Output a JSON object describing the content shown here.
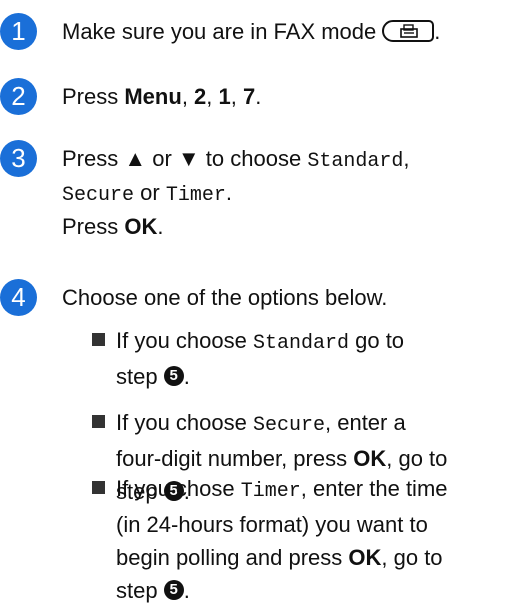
{
  "steps": [
    {
      "number": "1",
      "text": "Make sure you are in FAX mode",
      "end": "."
    },
    {
      "number": "2",
      "prefix": "Press ",
      "menu": "Menu",
      "sep1": ", ",
      "k1": "2",
      "sep2": ", ",
      "k2": "1",
      "sep3": ", ",
      "k3": "7",
      "end": "."
    },
    {
      "number": "3",
      "l1a": "Press ▲ or ▼ to choose ",
      "opt1": "Standard",
      "l1b": ",",
      "opt2": "Secure",
      "or": " or ",
      "opt3": "Timer",
      "l2end": ".",
      "press": "Press ",
      "ok": "OK",
      "end": "."
    },
    {
      "number": "4",
      "text": "Choose one of the options below."
    }
  ],
  "options": [
    {
      "l1": "If you choose ",
      "mode": "Standard",
      "l1b": " go to",
      "l2": "step ",
      "ref": "5",
      "end": "."
    },
    {
      "l1": "If you choose ",
      "mode": "Secure",
      "l1b": ", enter a",
      "l2": "four-digit number, press ",
      "ok": "OK",
      "l2b": ", go to",
      "l3": "step ",
      "ref": "5",
      "end": "."
    },
    {
      "l1": "If you chose ",
      "mode": "Timer",
      "l1b": ", enter the time",
      "l2": "(in 24-hours format) you want to",
      "l3": "begin polling and press ",
      "ok": "OK",
      "l3b": ", go to",
      "l4": "step ",
      "ref": "5",
      "end": "."
    }
  ],
  "colors": {
    "step_circle": "#1a6fd8"
  },
  "icons": {
    "fax_button": "fax-icon"
  }
}
